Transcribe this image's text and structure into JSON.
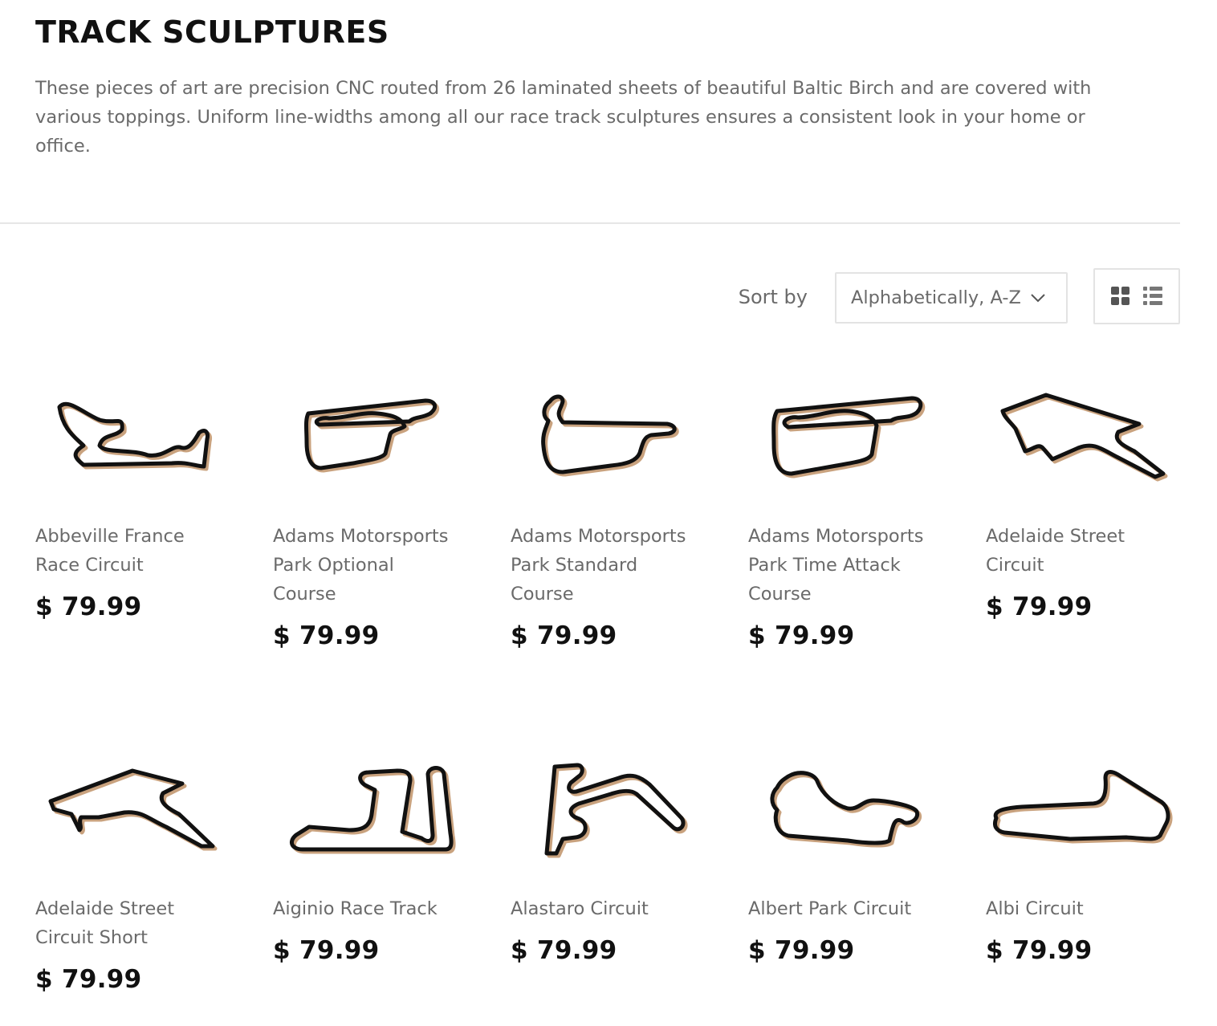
{
  "header": {
    "title": "TRACK SCULPTURES",
    "description": "These pieces of art are precision CNC routed from 26 laminated sheets of beautiful Baltic Birch and are covered with various toppings. Uniform line-widths among all our race track sculptures ensures a consistent look in your home or office."
  },
  "toolbar": {
    "sort_label": "Sort by",
    "sort_value": "Alphabetically, A-Z",
    "view_grid_icon": "grid-view-icon",
    "view_list_icon": "list-view-icon"
  },
  "products": [
    {
      "title": "Abbeville France Race Circuit",
      "price": "$ 79.99"
    },
    {
      "title": "Adams Motorsports Park Optional Course",
      "price": "$ 79.99"
    },
    {
      "title": "Adams Motorsports Park Standard Course",
      "price": "$ 79.99"
    },
    {
      "title": "Adams Motorsports Park Time Attack Course",
      "price": "$ 79.99"
    },
    {
      "title": "Adelaide Street Circuit",
      "price": "$ 79.99"
    },
    {
      "title": "Adelaide Street Circuit Short",
      "price": "$ 79.99"
    },
    {
      "title": "Aiginio Race Track",
      "price": "$ 79.99"
    },
    {
      "title": "Alastaro Circuit",
      "price": "$ 79.99"
    },
    {
      "title": "Albert Park Circuit",
      "price": "$ 79.99"
    },
    {
      "title": "Albi Circuit",
      "price": "$ 79.99"
    }
  ],
  "colors": {
    "text_dark": "#111111",
    "text_muted": "#6a6a6a",
    "border": "#e3e3e3",
    "track_shadow": "#c9a27e"
  }
}
